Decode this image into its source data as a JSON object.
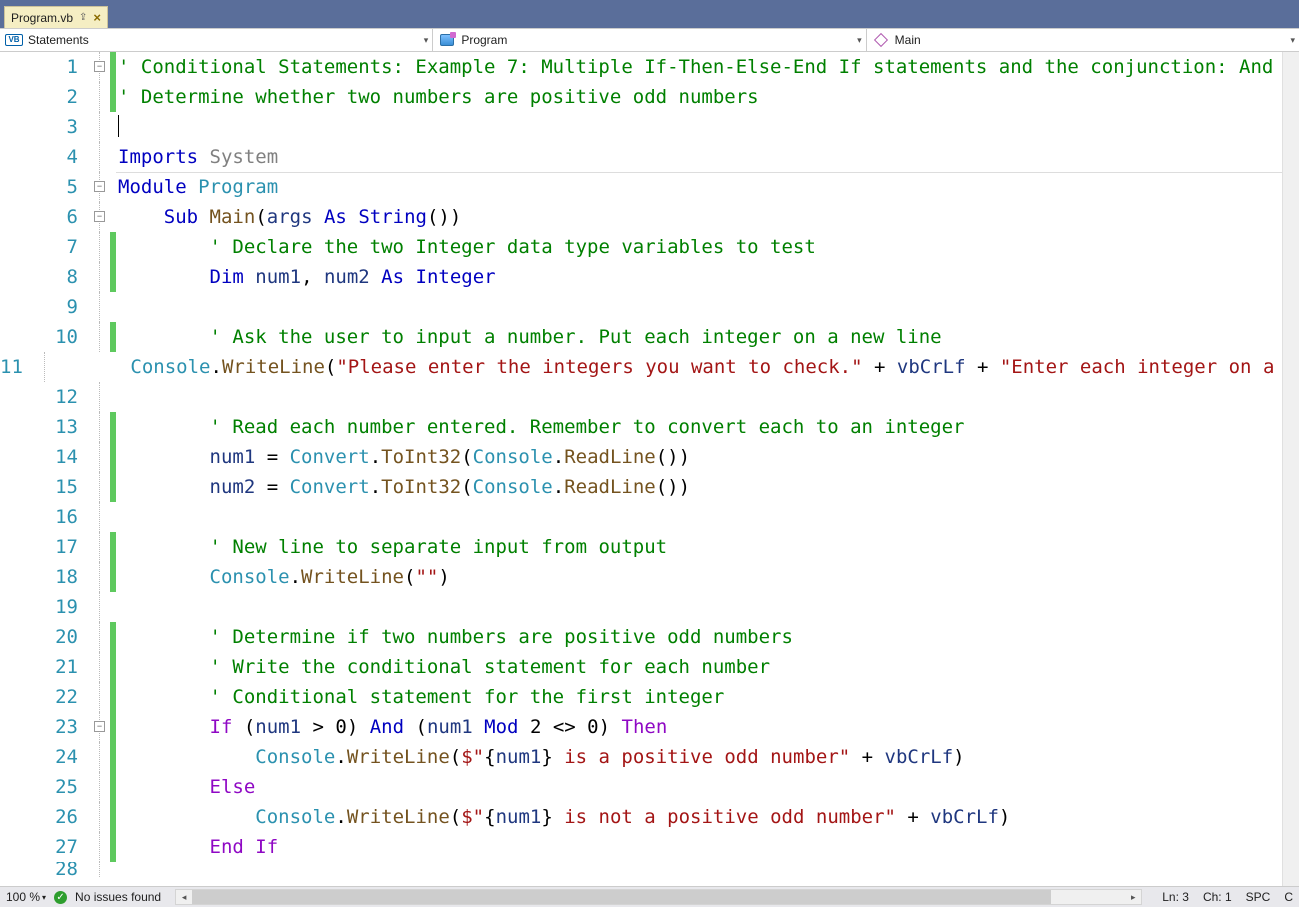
{
  "tab": {
    "name": "Program.vb"
  },
  "nav": {
    "scope": "Statements",
    "type": "Program",
    "member": "Main"
  },
  "lines": [
    {
      "n": 1,
      "mod": true,
      "fold": "-",
      "html": "<span class='c-comment'>' Conditional Statements: Example 7: Multiple If-Then-Else-End If statements and the conjunction: And</span>"
    },
    {
      "n": 2,
      "mod": true,
      "html": "<span class='c-comment'>' Determine whether two numbers are positive odd numbers</span>"
    },
    {
      "n": 3,
      "cursor": true,
      "html": ""
    },
    {
      "n": 4,
      "html": "<span class='c-key'>Imports</span> <span class='c-grey'>System</span>",
      "ruleAfter": true
    },
    {
      "n": 5,
      "fold": "-",
      "html": "<span class='c-module'>Module</span> <span class='c-id2'>Program</span>"
    },
    {
      "n": 6,
      "fold": "-",
      "indent": 1,
      "html": "<span class='c-key'>Sub</span> <span class='c-method'>Main</span>(<span class='c-ident'>args</span> <span class='c-key'>As</span> <span class='c-key'>String</span>())"
    },
    {
      "n": 7,
      "mod": true,
      "indent": 2,
      "html": "<span class='c-comment'>' Declare the two Integer data type variables to test</span>"
    },
    {
      "n": 8,
      "mod": true,
      "indent": 2,
      "html": "<span class='c-key'>Dim</span> <span class='c-ident'>num1</span>, <span class='c-ident'>num2</span> <span class='c-key'>As</span> <span class='c-key'>Integer</span>"
    },
    {
      "n": 9,
      "indent": 2,
      "html": ""
    },
    {
      "n": 10,
      "mod": true,
      "indent": 2,
      "html": "<span class='c-comment'>' Ask the user to input a number. Put each integer on a new line</span>"
    },
    {
      "n": 11,
      "mod": true,
      "indent": 2,
      "html": "<span class='c-id2'>Console</span>.<span class='c-method'>WriteLine</span>(<span class='c-str'>\"Please enter the integers you want to check.\"</span> + <span class='c-ident'>vbCrLf</span> + <span class='c-str'>\"Enter each integer on a new line\"</span>)"
    },
    {
      "n": 12,
      "indent": 2,
      "html": ""
    },
    {
      "n": 13,
      "mod": true,
      "indent": 2,
      "html": "<span class='c-comment'>' Read each number entered. Remember to convert each to an integer</span>"
    },
    {
      "n": 14,
      "mod": true,
      "indent": 2,
      "html": "<span class='c-ident'>num1</span> = <span class='c-id2'>Convert</span>.<span class='c-method'>ToInt32</span>(<span class='c-id2'>Console</span>.<span class='c-method'>ReadLine</span>())"
    },
    {
      "n": 15,
      "mod": true,
      "indent": 2,
      "html": "<span class='c-ident'>num2</span> = <span class='c-id2'>Convert</span>.<span class='c-method'>ToInt32</span>(<span class='c-id2'>Console</span>.<span class='c-method'>ReadLine</span>())"
    },
    {
      "n": 16,
      "indent": 2,
      "html": ""
    },
    {
      "n": 17,
      "mod": true,
      "indent": 2,
      "html": "<span class='c-comment'>' New line to separate input from output</span>"
    },
    {
      "n": 18,
      "mod": true,
      "indent": 2,
      "html": "<span class='c-id2'>Console</span>.<span class='c-method'>WriteLine</span>(<span class='c-str'>\"\"</span>)"
    },
    {
      "n": 19,
      "indent": 2,
      "html": ""
    },
    {
      "n": 20,
      "mod": true,
      "indent": 2,
      "html": "<span class='c-comment'>' Determine if two numbers are positive odd numbers</span>"
    },
    {
      "n": 21,
      "mod": true,
      "indent": 2,
      "html": "<span class='c-comment'>' Write the conditional statement for each number</span>"
    },
    {
      "n": 22,
      "mod": true,
      "indent": 2,
      "html": "<span class='c-comment'>' Conditional statement for the first integer</span>"
    },
    {
      "n": 23,
      "mod": true,
      "fold": "-",
      "indent": 2,
      "html": "<span class='c-purple'>If</span> (<span class='c-ident'>num1</span> &gt; <span class='c-black'>0</span>) <span class='c-key'>And</span> (<span class='c-ident'>num1</span> <span class='c-key'>Mod</span> <span class='c-black'>2</span> &lt;&gt; <span class='c-black'>0</span>) <span class='c-purple'>Then</span>"
    },
    {
      "n": 24,
      "mod": true,
      "indent": 3,
      "html": "<span class='c-id2'>Console</span>.<span class='c-method'>WriteLine</span>(<span class='c-str'>$\"</span><span class='c-black'>{</span><span class='c-ident'>num1</span><span class='c-black'>}</span><span class='c-str'> is a positive odd number\"</span> + <span class='c-ident'>vbCrLf</span>)"
    },
    {
      "n": 25,
      "mod": true,
      "indent": 2,
      "html": "<span class='c-purple'>Else</span>"
    },
    {
      "n": 26,
      "mod": true,
      "indent": 3,
      "html": "<span class='c-id2'>Console</span>.<span class='c-method'>WriteLine</span>(<span class='c-str'>$\"</span><span class='c-black'>{</span><span class='c-ident'>num1</span><span class='c-black'>}</span><span class='c-str'> is not a positive odd number\"</span> + <span class='c-ident'>vbCrLf</span>)"
    },
    {
      "n": 27,
      "mod": true,
      "indent": 2,
      "html": "<span class='c-purple'>End If</span>"
    },
    {
      "n": 28,
      "partial": true,
      "indent": 2,
      "html": ""
    }
  ],
  "status": {
    "zoom": "100 %",
    "issues": "No issues found",
    "ln": "Ln: 3",
    "ch": "Ch: 1",
    "ins": "SPC",
    "extra": "C"
  }
}
